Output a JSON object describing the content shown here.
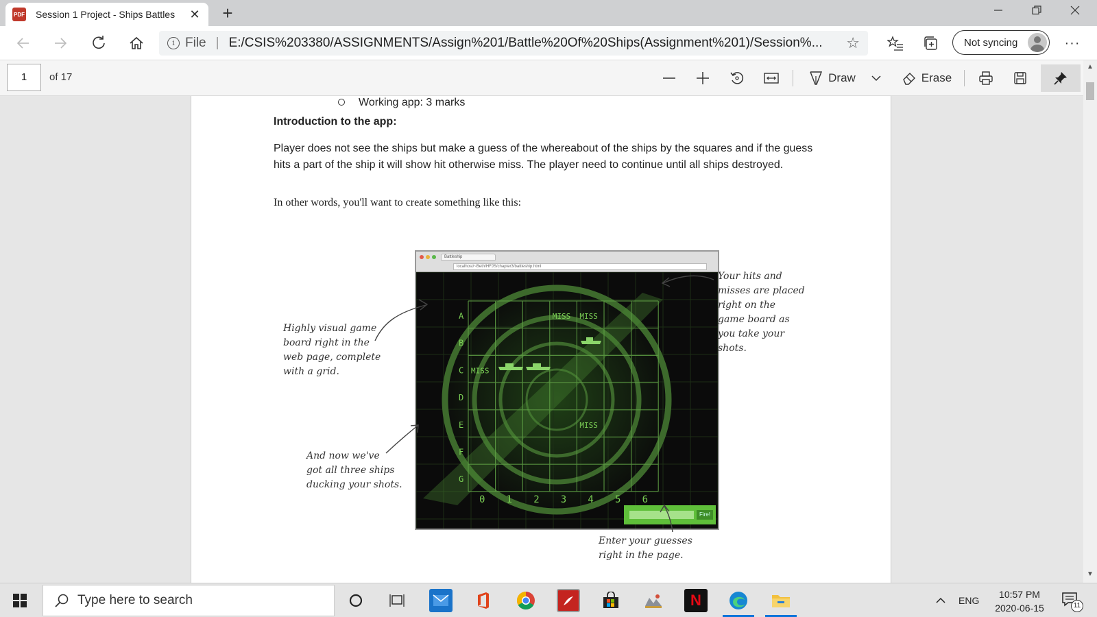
{
  "browser": {
    "tab_title": "Session 1 Project - Ships Battles",
    "new_tab_symbol": "+",
    "close_symbol": "✕",
    "file_label": "File",
    "url": "E:/CSIS%203380/ASSIGNMENTS/Assign%201/Battle%20Of%20Ships(Assignment%201)/Session%...",
    "sync_label": "Not syncing"
  },
  "pdf_toolbar": {
    "page_number": "1",
    "page_total": "of 17",
    "draw_label": "Draw",
    "erase_label": "Erase"
  },
  "document": {
    "bullet_text": "Working app: 3 marks",
    "intro_heading": "Introduction to the app:",
    "intro_paragraph": "Player does not see the ships but make a guess of the whereabout of the ships by the squares and if the guess hits a part of the ship it will show hit otherwise miss. The player need to continue until all ships destroyed.",
    "lead_in": "In other words, you'll want to create something like this:"
  },
  "figure": {
    "chrome_tab": "Battleship",
    "chrome_url": "localhost/~Beth/HFJS/chapter3/battleship.html",
    "rows": [
      "A",
      "B",
      "C",
      "D",
      "E",
      "F",
      "G"
    ],
    "cols": [
      "0",
      "1",
      "2",
      "3",
      "4",
      "5",
      "6"
    ],
    "miss_label": "MISS",
    "fire_label": "Fire!",
    "annotations": {
      "left_top": [
        "Highly visual game",
        "board right in the",
        "web page, complete",
        "with a grid."
      ],
      "left_bottom": [
        "And now we've",
        "got all three ships",
        "ducking your shots."
      ],
      "right": [
        "Your hits and",
        "misses are placed",
        "right on the",
        "game board as",
        "you take your",
        "shots."
      ],
      "bottom": [
        "Enter your guesses",
        "right in the page."
      ]
    }
  },
  "taskbar": {
    "search_placeholder": "Type here to search",
    "language": "ENG",
    "time": "10:57 PM",
    "date": "2020-06-15",
    "notification_count": "11"
  }
}
